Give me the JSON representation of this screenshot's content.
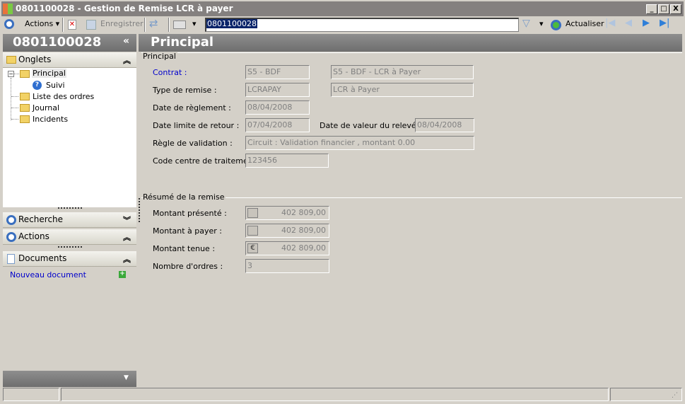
{
  "window": {
    "title": "0801100028 -  Gestion de Remise LCR à payer",
    "minimize": "_",
    "maximize": "□",
    "close": "X"
  },
  "toolbar": {
    "actions": "Actions",
    "save": "Enregistrer",
    "search_value": "0801100028",
    "refresh": "Actualiser"
  },
  "sidebar": {
    "title": "0801100028",
    "collapse": "«",
    "onglets": "Onglets",
    "tree": [
      {
        "label": "Principal"
      },
      {
        "label": "Suivi"
      },
      {
        "label": "Liste des ordres"
      },
      {
        "label": "Journal"
      },
      {
        "label": "Incidents"
      }
    ],
    "recherche": "Recherche",
    "actions": "Actions",
    "documents": "Documents",
    "new_document": "Nouveau document"
  },
  "main": {
    "title": "Principal",
    "principal": {
      "legend": "Principal",
      "contrat": {
        "label": "Contrat :",
        "value1": "S5 - BDF",
        "value2": "S5 - BDF - LCR à Payer"
      },
      "type": {
        "label": "Type de remise :",
        "value1": "LCRAPAY",
        "value2": "LCR à Payer"
      },
      "date_reglement": {
        "label": "Date de règlement :",
        "value": "08/04/2008"
      },
      "date_limite": {
        "label": "Date limite de retour :",
        "value": "07/04/2008"
      },
      "date_valeur": {
        "label": "Date de valeur du relevé :",
        "value": "08/04/2008"
      },
      "regle": {
        "label": "Règle de validation :",
        "value": "Circuit : Validation financier , montant 0.00"
      },
      "code": {
        "label": "Code centre de traitement :",
        "value": "123456"
      }
    },
    "resume": {
      "legend": "Résumé de la remise",
      "presente": {
        "label": "Montant présenté :",
        "value": "402 809,00"
      },
      "a_payer": {
        "label": "Montant à payer :",
        "value": "402 809,00"
      },
      "tenue": {
        "label": "Montant tenue :",
        "value": "402 809,00",
        "currency": "€"
      },
      "nb_ordres": {
        "label": "Nombre d'ordres :",
        "value": "3"
      }
    }
  }
}
